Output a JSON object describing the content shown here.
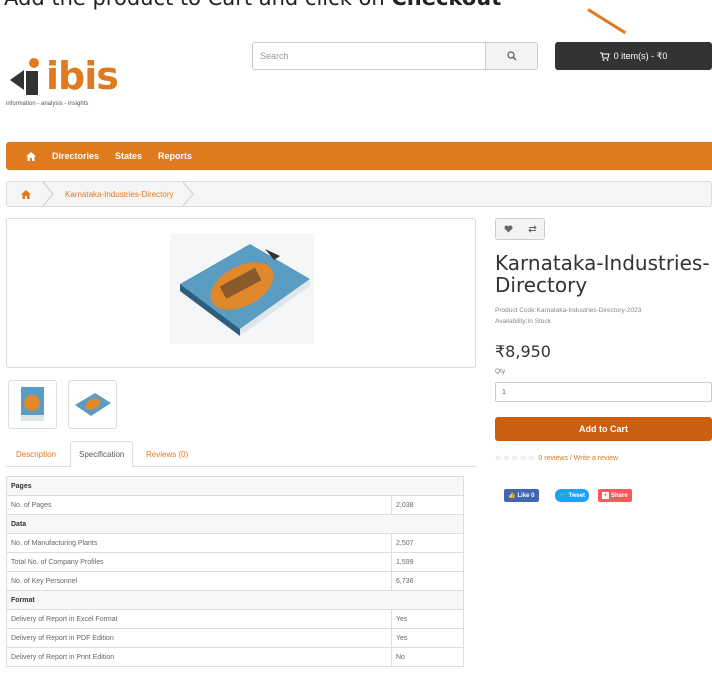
{
  "caption": {
    "prefix": "Add the product to Cart and click on ",
    "bold": "Checkout"
  },
  "header": {
    "logo_text": "ibis",
    "tagline": "information - analysis - insights",
    "search_placeholder": "Search",
    "cart_label": "0 item(s) - ₹0"
  },
  "nav": {
    "items": [
      "Directories",
      "States",
      "Reports"
    ]
  },
  "breadcrumb": {
    "current": "Karnataka-Industries-Directory"
  },
  "tabs": [
    "Description",
    "Specification",
    "Reviews (0)"
  ],
  "spec": {
    "groups": [
      {
        "name": "Pages",
        "rows": [
          {
            "label": "No. of Pages",
            "value": "2,038"
          }
        ]
      },
      {
        "name": "Data",
        "rows": [
          {
            "label": "No. of Manufacturing Plants",
            "value": "2,507"
          },
          {
            "label": "Total No. of Company Profiles",
            "value": "1,599"
          },
          {
            "label": "No. of Key Personnel",
            "value": "6,736"
          }
        ]
      },
      {
        "name": "Format",
        "rows": [
          {
            "label": "Delivery of Report in Excel Format",
            "value": "Yes"
          },
          {
            "label": "Delivery of Report in PDF Edition",
            "value": "Yes"
          },
          {
            "label": "Delivery of Report in Print Edition",
            "value": "No"
          }
        ]
      }
    ]
  },
  "product": {
    "title": "Karnataka-Industries-Directory",
    "code": "Product Code:Karnataka-Industries-Directory-2023",
    "availability": "Availability:In Stock",
    "price": "₹8,950",
    "qty_label": "Qty",
    "qty_value": "1",
    "add_to_cart": "Add to Cart",
    "reviews_link": "0 reviews / Write a review",
    "rating": 0
  },
  "social": {
    "like": "Like 0",
    "tweet": "Tweet",
    "share": "Share"
  },
  "colors": {
    "accent": "#e07a1f",
    "dark": "#333333",
    "cart_button": "#c95f0f"
  }
}
